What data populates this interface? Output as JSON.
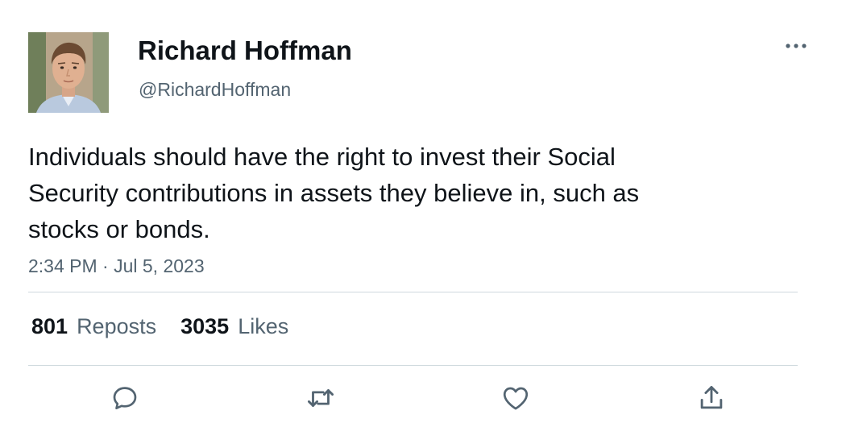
{
  "author": {
    "display_name": "Richard Hoffman",
    "handle": "@RichardHoffman",
    "avatar_icon": "avatar-photo"
  },
  "tweet": {
    "text": "Individuals should have the right to invest their Social Security contributions in assets they believe in, such as stocks or bonds.",
    "timestamp": "2:34 PM · Jul 5, 2023"
  },
  "stats": {
    "reposts_count": "801",
    "reposts_label": "Reposts",
    "likes_count": "3035",
    "likes_label": "Likes"
  },
  "actions": {
    "reply_icon": "speech-bubble-icon",
    "repost_icon": "repost-arrows-icon",
    "like_icon": "heart-icon",
    "share_icon": "share-upload-icon",
    "more_icon": "ellipsis-icon"
  },
  "colors": {
    "text_primary": "#0f1419",
    "text_secondary": "#536471",
    "divider": "#cfd9de"
  }
}
